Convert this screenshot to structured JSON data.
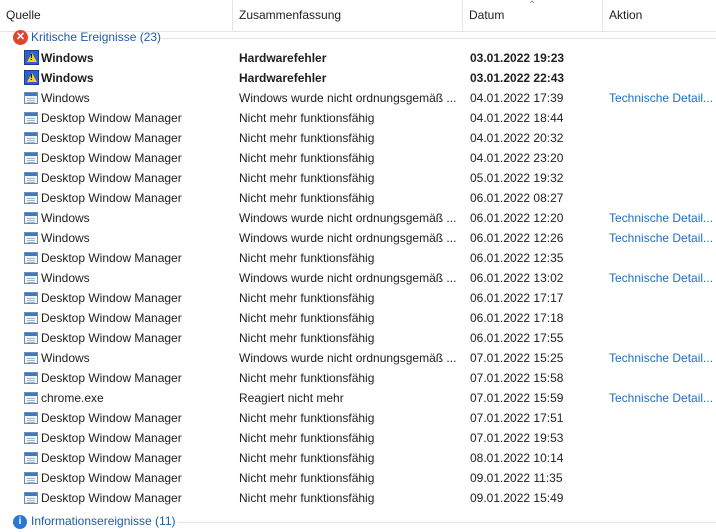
{
  "columns": {
    "source": "Quelle",
    "summary": "Zusammenfassung",
    "date": "Datum",
    "action": "Aktion"
  },
  "groups": {
    "critical": "Kritische Ereignisse (23)",
    "info": "Informationsereignisse (11)"
  },
  "rows": [
    {
      "icon": "warning-icon",
      "source": "Windows",
      "summary": "Hardwarefehler",
      "date": "03.01.2022 19:23",
      "action": "",
      "bold": true
    },
    {
      "icon": "warning-icon",
      "source": "Windows",
      "summary": "Hardwarefehler",
      "date": "03.01.2022 22:43",
      "action": "",
      "bold": true
    },
    {
      "icon": "app-window-icon",
      "source": "Windows",
      "summary": "Windows wurde nicht ordnungsgemäß ...",
      "date": "04.01.2022 17:39",
      "action": "Technische Detail..."
    },
    {
      "icon": "app-window-icon",
      "source": "Desktop Window Manager",
      "summary": "Nicht mehr funktionsfähig",
      "date": "04.01.2022 18:44",
      "action": ""
    },
    {
      "icon": "app-window-icon",
      "source": "Desktop Window Manager",
      "summary": "Nicht mehr funktionsfähig",
      "date": "04.01.2022 20:32",
      "action": ""
    },
    {
      "icon": "app-window-icon",
      "source": "Desktop Window Manager",
      "summary": "Nicht mehr funktionsfähig",
      "date": "04.01.2022 23:20",
      "action": ""
    },
    {
      "icon": "app-window-icon",
      "source": "Desktop Window Manager",
      "summary": "Nicht mehr funktionsfähig",
      "date": "05.01.2022 19:32",
      "action": ""
    },
    {
      "icon": "app-window-icon",
      "source": "Desktop Window Manager",
      "summary": "Nicht mehr funktionsfähig",
      "date": "06.01.2022 08:27",
      "action": ""
    },
    {
      "icon": "app-window-icon",
      "source": "Windows",
      "summary": "Windows wurde nicht ordnungsgemäß ...",
      "date": "06.01.2022 12:20",
      "action": "Technische Detail..."
    },
    {
      "icon": "app-window-icon",
      "source": "Windows",
      "summary": "Windows wurde nicht ordnungsgemäß ...",
      "date": "06.01.2022 12:26",
      "action": "Technische Detail..."
    },
    {
      "icon": "app-window-icon",
      "source": "Desktop Window Manager",
      "summary": "Nicht mehr funktionsfähig",
      "date": "06.01.2022 12:35",
      "action": ""
    },
    {
      "icon": "app-window-icon",
      "source": "Windows",
      "summary": "Windows wurde nicht ordnungsgemäß ...",
      "date": "06.01.2022 13:02",
      "action": "Technische Detail..."
    },
    {
      "icon": "app-window-icon",
      "source": "Desktop Window Manager",
      "summary": "Nicht mehr funktionsfähig",
      "date": "06.01.2022 17:17",
      "action": ""
    },
    {
      "icon": "app-window-icon",
      "source": "Desktop Window Manager",
      "summary": "Nicht mehr funktionsfähig",
      "date": "06.01.2022 17:18",
      "action": ""
    },
    {
      "icon": "app-window-icon",
      "source": "Desktop Window Manager",
      "summary": "Nicht mehr funktionsfähig",
      "date": "06.01.2022 17:55",
      "action": ""
    },
    {
      "icon": "app-window-icon",
      "source": "Windows",
      "summary": "Windows wurde nicht ordnungsgemäß ...",
      "date": "07.01.2022 15:25",
      "action": "Technische Detail..."
    },
    {
      "icon": "app-window-icon",
      "source": "Desktop Window Manager",
      "summary": "Nicht mehr funktionsfähig",
      "date": "07.01.2022 15:58",
      "action": ""
    },
    {
      "icon": "app-window-icon",
      "source": "chrome.exe",
      "summary": "Reagiert nicht mehr",
      "date": "07.01.2022 15:59",
      "action": "Technische Detail..."
    },
    {
      "icon": "app-window-icon",
      "source": "Desktop Window Manager",
      "summary": "Nicht mehr funktionsfähig",
      "date": "07.01.2022 17:51",
      "action": ""
    },
    {
      "icon": "app-window-icon",
      "source": "Desktop Window Manager",
      "summary": "Nicht mehr funktionsfähig",
      "date": "07.01.2022 19:53",
      "action": ""
    },
    {
      "icon": "app-window-icon",
      "source": "Desktop Window Manager",
      "summary": "Nicht mehr funktionsfähig",
      "date": "08.01.2022 10:14",
      "action": ""
    },
    {
      "icon": "app-window-icon",
      "source": "Desktop Window Manager",
      "summary": "Nicht mehr funktionsfähig",
      "date": "09.01.2022 11:35",
      "action": ""
    },
    {
      "icon": "app-window-icon",
      "source": "Desktop Window Manager",
      "summary": "Nicht mehr funktionsfähig",
      "date": "09.01.2022 15:49",
      "action": ""
    }
  ],
  "colors": {
    "accent_link": "#1e6fc8",
    "group_label": "#1e5aa8",
    "critical_icon": "#e0442f",
    "info_icon": "#2b78d4"
  }
}
